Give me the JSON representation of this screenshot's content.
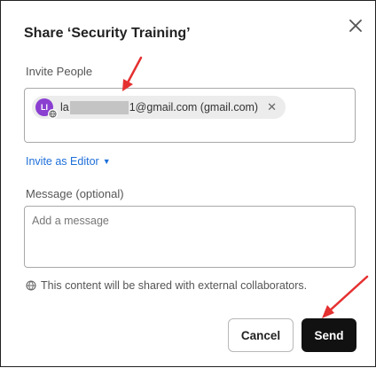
{
  "dialog": {
    "title": "Share ‘Security Training’"
  },
  "invite": {
    "label": "Invite People",
    "chip": {
      "avatar_initials": "LI",
      "email_prefix": "la",
      "email_suffix": "1@gmail.com (gmail.com)",
      "avatar_color": "#8a3fd1"
    },
    "role_link": "Invite as Editor"
  },
  "message": {
    "label": "Message (optional)",
    "placeholder": "Add a message"
  },
  "notice": "This content will be shared with external collaborators.",
  "buttons": {
    "cancel": "Cancel",
    "send": "Send"
  },
  "colors": {
    "link": "#1e6fd9",
    "primary_button": "#111111",
    "annotation_arrow": "#e53030"
  }
}
